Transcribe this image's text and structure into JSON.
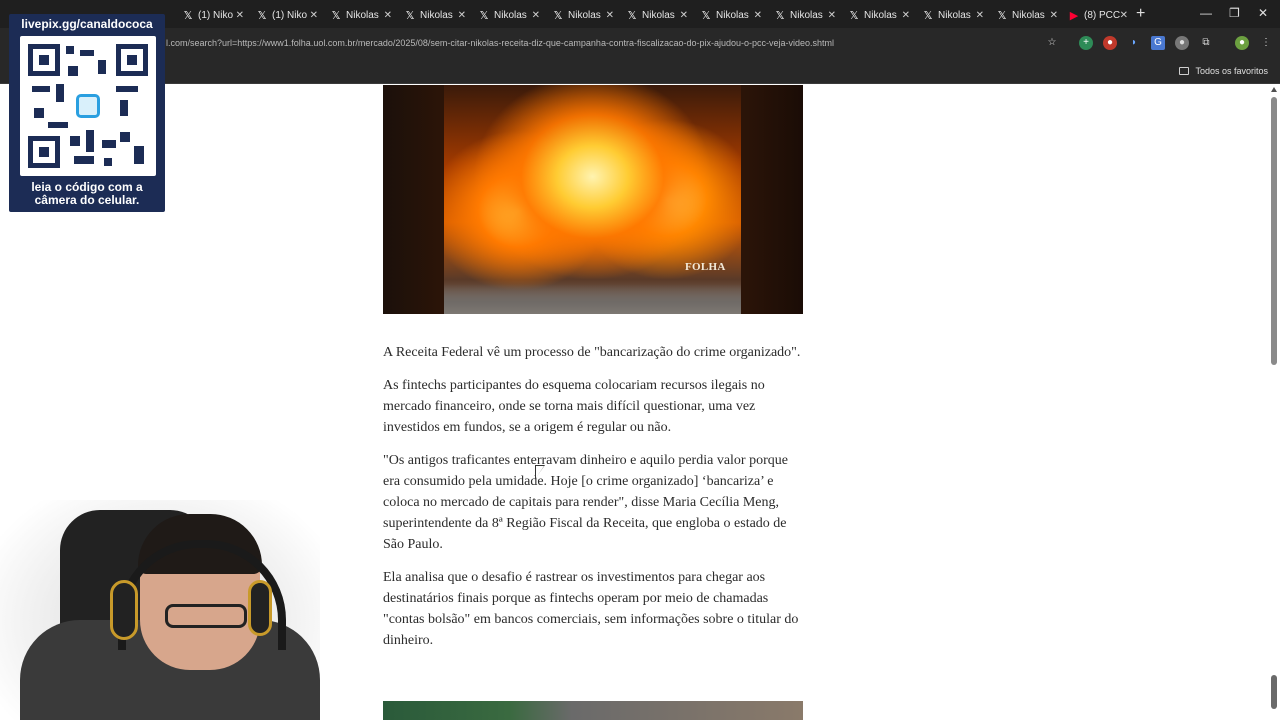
{
  "browser": {
    "tabs": [
      {
        "title": "(1) Niko",
        "icon": "x-logo-icon"
      },
      {
        "title": "(1) Niko",
        "icon": "x-logo-icon"
      },
      {
        "title": "Nikolas",
        "icon": "x-logo-icon"
      },
      {
        "title": "Nikolas",
        "icon": "x-logo-icon"
      },
      {
        "title": "Nikolas",
        "icon": "x-logo-icon"
      },
      {
        "title": "Nikolas",
        "icon": "x-logo-icon"
      },
      {
        "title": "Nikolas",
        "icon": "x-logo-icon"
      },
      {
        "title": "Nikolas",
        "icon": "x-logo-icon"
      },
      {
        "title": "Nikolas",
        "icon": "x-logo-icon"
      },
      {
        "title": "Nikolas",
        "icon": "x-logo-icon"
      },
      {
        "title": "Nikolas",
        "icon": "x-logo-icon"
      },
      {
        "title": "Nikolas",
        "icon": "x-logo-icon"
      },
      {
        "title": "(8) PCC",
        "icon": "youtube-icon"
      }
    ],
    "url": "l.com/search?url=https://www1.folha.uol.com.br/mercado/2025/08/sem-citar-nikolas-receita-diz-que-campanha-contra-fiscalizacao-do-pix-ajudou-o-pcc-veja-video.shtml",
    "bookmarks_label": "Todos os favoritos"
  },
  "article": {
    "image_watermark": "FOLHA",
    "paragraphs": [
      "A Receita Federal vê um processo de \"bancarização do crime organizado\".",
      "As fintechs participantes do esquema colocariam recursos ilegais no mercado financeiro, onde se torna mais difícil questionar, uma vez investidos em fundos, se a origem é regular ou não.",
      "\"Os antigos traficantes enterravam dinheiro e aquilo perdia valor porque era consumido pela umidade. Hoje [o crime organizado] ‘bancariza’ e coloca no mercado de capitais para render\", disse Maria Cecília Meng, superintendente da 8ª Região Fiscal da Receita, que engloba o estado de São Paulo.",
      "Ela analisa que o desafio é rastrear os investimentos para chegar aos destinatários finais porque as fintechs operam por meio de chamadas \"contas bolsão\" em bancos comerciais, sem informações sobre o titular do dinheiro."
    ]
  },
  "overlay": {
    "qr_title": "livepix.gg/canaldococa",
    "qr_caption_line1": "leia o código com a",
    "qr_caption_line2": "câmera do celular."
  }
}
